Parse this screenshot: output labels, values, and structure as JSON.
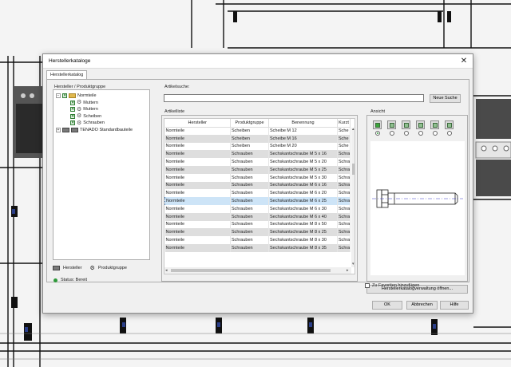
{
  "window": {
    "title": "Herstellerkataloge",
    "tab": "Herstellerkatalog"
  },
  "left_panel": {
    "group_label": "Hersteller / Produktgruppe",
    "tree": [
      {
        "label": "Normteile",
        "checked": true,
        "icon": "folder-icon",
        "expanded": true
      },
      {
        "label": "Muttern",
        "checked": true,
        "icon": "gear-icon"
      },
      {
        "label": "Muttern",
        "checked": true,
        "icon": "gear-icon"
      },
      {
        "label": "Scheiben",
        "checked": true,
        "icon": "gear-icon"
      },
      {
        "label": "Schrauben",
        "checked": true,
        "icon": "gear-icon"
      },
      {
        "label": "TENADO Standardbauteile",
        "checked": false,
        "icon": "folder-icon",
        "expanded": false
      }
    ],
    "footer": {
      "manufacturer_label": "Hersteller",
      "product_group_label": "Produktgruppe"
    }
  },
  "status": {
    "label": "Status: Bereit"
  },
  "search": {
    "label": "Artikelsuche:",
    "value": "",
    "button_label": "Neue Suche"
  },
  "article_list": {
    "group_label": "Artikelliste",
    "columns": [
      "Hersteller",
      "Produktgruppe",
      "Benennung",
      "Kurzt"
    ],
    "selected_index": 9,
    "rows": [
      [
        "Normteile",
        "Scheiben",
        "Scheibe M 12",
        "Sche"
      ],
      [
        "Normteile",
        "Scheiben",
        "Scheibe M 16",
        "Sche"
      ],
      [
        "Normteile",
        "Scheiben",
        "Scheibe M 20",
        "Sche"
      ],
      [
        "Normteile",
        "Schrauben",
        "Sechskantschraube M 5 x 16",
        "Schra"
      ],
      [
        "Normteile",
        "Schrauben",
        "Sechskantschraube M 5 x 20",
        "Schra"
      ],
      [
        "Normteile",
        "Schrauben",
        "Sechskantschraube M 5 x 25",
        "Schra"
      ],
      [
        "Normteile",
        "Schrauben",
        "Sechskantschraube M 5 x 30",
        "Schra"
      ],
      [
        "Normteile",
        "Schrauben",
        "Sechskantschraube M 6 x 16",
        "Schra"
      ],
      [
        "Normteile",
        "Schrauben",
        "Sechskantschraube M 6 x 20",
        "Schra"
      ],
      [
        "Normteile",
        "Schrauben",
        "Sechskantschraube M 6 x 25",
        "Schra"
      ],
      [
        "Normteile",
        "Schrauben",
        "Sechskantschraube M 6 x 30",
        "Schra"
      ],
      [
        "Normteile",
        "Schrauben",
        "Sechskantschraube M 6 x 40",
        "Schra"
      ],
      [
        "Normteile",
        "Schrauben",
        "Sechskantschraube M 8 x 50",
        "Schra"
      ],
      [
        "Normteile",
        "Schrauben",
        "Sechskantschraube M 8 x 25",
        "Schra"
      ],
      [
        "Normteile",
        "Schrauben",
        "Sechskantschraube M 8 x 30",
        "Schra"
      ],
      [
        "Normteile",
        "Schrauben",
        "Sechskantschraube M 8 x 35",
        "Schra"
      ]
    ]
  },
  "preview": {
    "group_label": "Ansicht",
    "view_buttons": [
      "iso-view-icon",
      "front-view-icon",
      "back-view-icon",
      "left-view-icon",
      "right-view-icon",
      "top-view-icon"
    ],
    "active_view": 0,
    "open_button_label": "Herstellerkatalogverwaltung öffnen...",
    "favorites_label": "Zu Favoriten hinzufügen",
    "favorites_checked": false
  },
  "footer_buttons": {
    "ok": "OK",
    "cancel": "Abbrechen",
    "help": "Hilfe"
  },
  "colors": {
    "accent_green": "#2e9a3a",
    "selection": "#cde4f7",
    "row_alt": "#dedede",
    "preview_line": "#3a3ac8"
  }
}
